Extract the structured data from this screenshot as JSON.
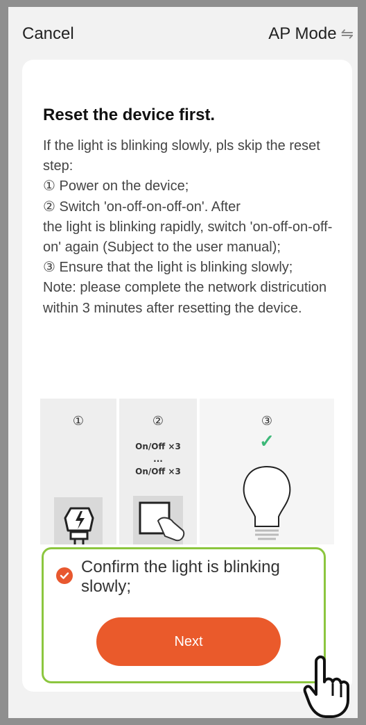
{
  "topbar": {
    "cancel_label": "Cancel",
    "mode_label": "AP Mode",
    "mode_icon": "⇋"
  },
  "card": {
    "title": "Reset the device first.",
    "instructions": [
      "If the light is blinking slowly, pls skip the reset step:",
      "① Power on the device;",
      "② Switch 'on-off-on-off-on'. After\nthe light is blinking rapidly, switch 'on-off-on-off-on' again (Subject to the user manual);",
      "③ Ensure that the light is blinking slowly;",
      "Note: please complete the network districution within 3 minutes after resetting the device."
    ]
  },
  "illustration": {
    "step1_num": "①",
    "step2_num": "②",
    "step3_num": "③",
    "onoff_top": "On/Off ×3",
    "onoff_ellipsis": "...",
    "onoff_bottom": "On/Off ×3",
    "check_icon": "✓"
  },
  "confirm": {
    "label": "Confirm the light is blinking slowly;",
    "checked": true
  },
  "next_label": "Next",
  "colors": {
    "accent": "#ea5a2b",
    "highlight_border": "#8cc63f",
    "check_green": "#3cb878"
  }
}
